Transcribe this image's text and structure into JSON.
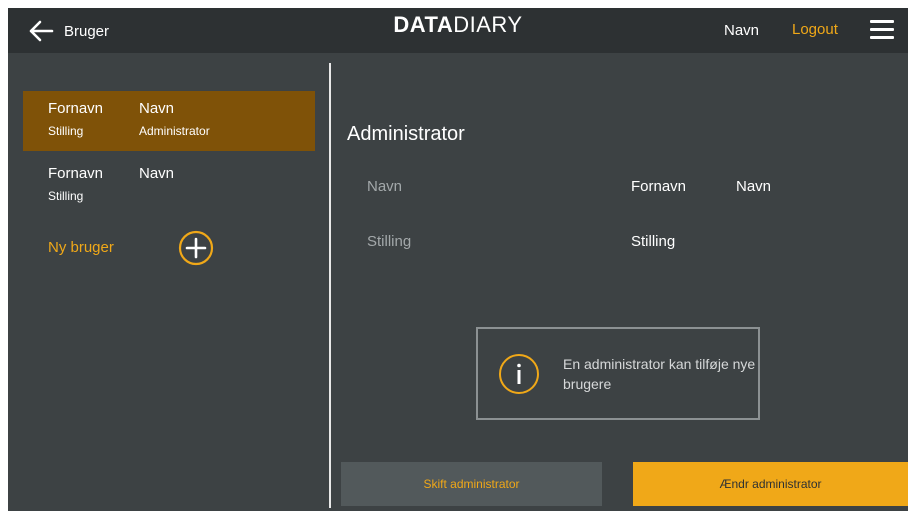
{
  "colors": {
    "accent": "#f0a818",
    "selected_row": "#7f5208",
    "background": "#3d4244",
    "topbar": "#2d3133"
  },
  "header": {
    "back_label": "Bruger",
    "logo_bold": "DATA",
    "logo_light": "DIARY",
    "user_name": "Navn",
    "logout_label": "Logout"
  },
  "sidebar": {
    "users": [
      {
        "first_name": "Fornavn",
        "last_name": "Navn",
        "title": "Stilling",
        "role": "Administrator",
        "selected": true
      },
      {
        "first_name": "Fornavn",
        "last_name": "Navn",
        "title": "Stilling",
        "role": "",
        "selected": false
      }
    ],
    "new_user_label": "Ny bruger"
  },
  "detail": {
    "heading": "Administrator",
    "name_label": "Navn",
    "first_name": "Fornavn",
    "last_name": "Navn",
    "title_label": "Stilling",
    "title_value": "Stilling",
    "info_text": "En administrator kan tilføje nye brugere"
  },
  "actions": {
    "switch_admin": "Skift administrator",
    "edit_admin": "Ændr administrator"
  },
  "icons": [
    "back-arrow-icon",
    "menu-icon",
    "add-circle-icon",
    "info-icon"
  ]
}
